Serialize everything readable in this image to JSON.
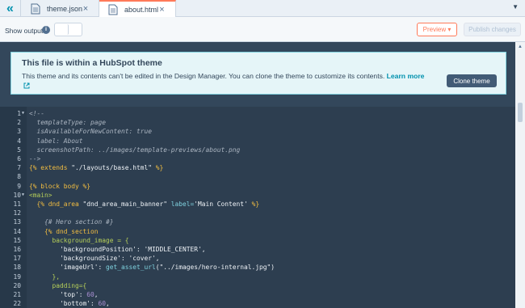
{
  "tabs": {
    "collapse_icon": "double-chevron-left-icon",
    "items": [
      {
        "label": "theme.json",
        "close": "×"
      },
      {
        "label": "about.html",
        "close": "×"
      }
    ],
    "menu_icon": "caret-down-icon",
    "menu": "▼"
  },
  "toolbar": {
    "show_output": "Show output",
    "info": "i",
    "preview": "Preview ▾",
    "publish": "Publish changes"
  },
  "banner": {
    "title": "This file is within a HubSpot theme",
    "text": "This theme and its contents can't be edited in the Design Manager. You can clone the theme to customize its contents.",
    "learn_more": "Learn more",
    "clone": "Clone theme"
  },
  "code": {
    "lines": [
      {
        "n": "1",
        "fold": true,
        "parts": [
          {
            "c": "cm",
            "t": "<!--"
          }
        ]
      },
      {
        "n": "2",
        "parts": [
          {
            "c": "cm",
            "t": "  templateType: page"
          }
        ]
      },
      {
        "n": "3",
        "parts": [
          {
            "c": "cm",
            "t": "  isAvailableForNewContent: true"
          }
        ]
      },
      {
        "n": "4",
        "parts": [
          {
            "c": "cm",
            "t": "  label: About"
          }
        ]
      },
      {
        "n": "5",
        "parts": [
          {
            "c": "cm",
            "t": "  screenshotPath: ../images/template-previews/about.png"
          }
        ]
      },
      {
        "n": "6",
        "parts": [
          {
            "c": "cm",
            "t": "-->"
          }
        ]
      },
      {
        "n": "7",
        "parts": [
          {
            "c": "kw",
            "t": "{% extends "
          },
          {
            "c": "str",
            "t": "\"./layouts/base.html\""
          },
          {
            "c": "kw",
            "t": " %}"
          }
        ]
      },
      {
        "n": "8",
        "parts": []
      },
      {
        "n": "9",
        "parts": [
          {
            "c": "kw",
            "t": "{% block body %}"
          }
        ]
      },
      {
        "n": "10",
        "fold": true,
        "parts": [
          {
            "c": "br",
            "t": "<main>"
          }
        ]
      },
      {
        "n": "11",
        "parts": [
          {
            "c": "kw",
            "t": "  {% dnd_area "
          },
          {
            "c": "str",
            "t": "\"dnd_area_main_banner\""
          },
          {
            "c": "attr",
            "t": " label="
          },
          {
            "c": "str",
            "t": "'Main Content'"
          },
          {
            "c": "kw",
            "t": " %}"
          }
        ]
      },
      {
        "n": "12",
        "parts": []
      },
      {
        "n": "13",
        "parts": [
          {
            "c": "cm",
            "t": "    {# Hero section #}"
          }
        ]
      },
      {
        "n": "14",
        "parts": [
          {
            "c": "kw",
            "t": "    {% dnd_section"
          }
        ]
      },
      {
        "n": "15",
        "parts": [
          {
            "c": "br",
            "t": "      background_image = {"
          }
        ]
      },
      {
        "n": "16",
        "parts": [
          {
            "c": "str",
            "t": "        'backgroundPosition': 'MIDDLE_CENTER',"
          }
        ]
      },
      {
        "n": "17",
        "parts": [
          {
            "c": "str",
            "t": "        'backgroundSize': 'cover',"
          }
        ]
      },
      {
        "n": "18",
        "parts": [
          {
            "c": "str",
            "t": "        'imageUrl': "
          },
          {
            "c": "fn",
            "t": "get_asset_url"
          },
          {
            "c": "str",
            "t": "(\"../images/hero-internal.jpg\")"
          }
        ]
      },
      {
        "n": "19",
        "parts": [
          {
            "c": "br",
            "t": "      },"
          }
        ]
      },
      {
        "n": "20",
        "parts": [
          {
            "c": "br",
            "t": "      padding={"
          }
        ]
      },
      {
        "n": "21",
        "parts": [
          {
            "c": "str",
            "t": "        'top': "
          },
          {
            "c": "num",
            "t": "60"
          },
          {
            "c": "str",
            "t": ","
          }
        ]
      },
      {
        "n": "22",
        "parts": [
          {
            "c": "str",
            "t": "        'bottom': "
          },
          {
            "c": "num",
            "t": "60"
          },
          {
            "c": "str",
            "t": ","
          }
        ]
      }
    ]
  }
}
